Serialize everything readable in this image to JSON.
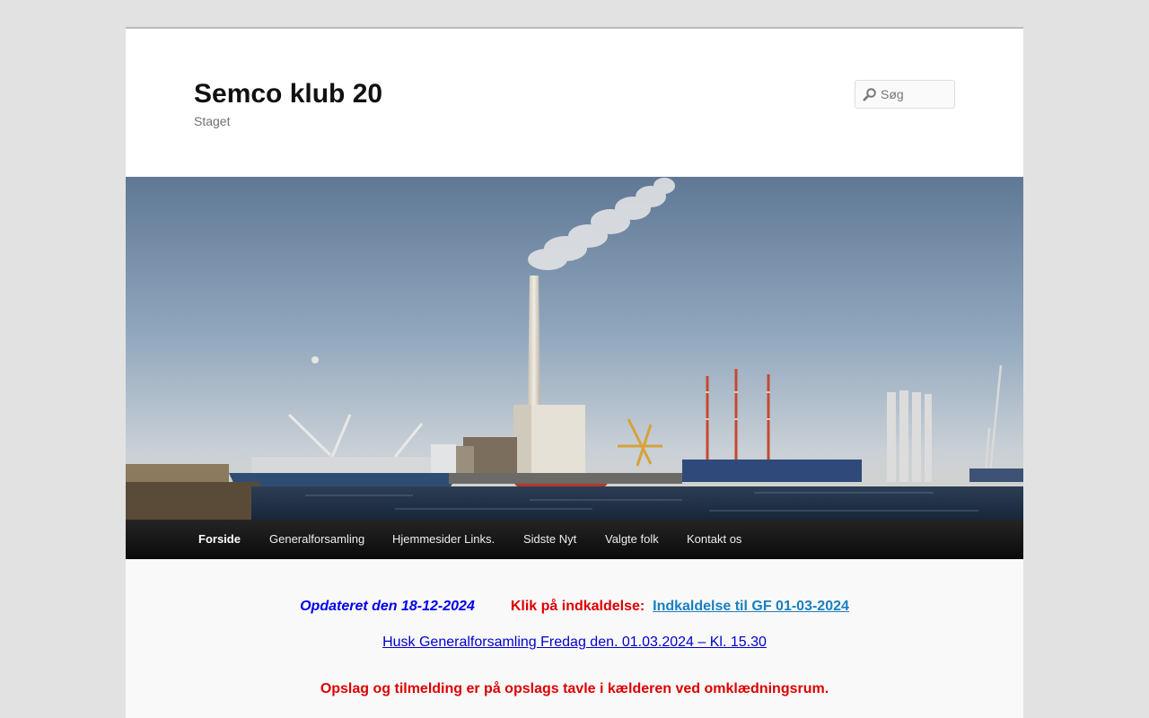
{
  "site": {
    "title": "Semco klub 20",
    "tagline": "Staget"
  },
  "search": {
    "placeholder": "Søg",
    "icon": "search-icon"
  },
  "nav": {
    "items": [
      {
        "label": "Forside",
        "active": true
      },
      {
        "label": "Generalforsamling"
      },
      {
        "label": "Hjemmesider Links."
      },
      {
        "label": "Sidste Nyt"
      },
      {
        "label": "Valgte folk"
      },
      {
        "label": "Kontakt os"
      }
    ]
  },
  "content": {
    "updated": "Opdateret den 18-12-2024",
    "klik_label": "Klik på indkaldelse:",
    "invitation_link": "Indkaldelse til GF 01-03-2024",
    "reminder_link": "Husk Generalforsamling Fredag den. 01.03.2024 – Kl. 15.30",
    "notice": "Opslag og tilmelding er på opslags tavle i kælderen ved omklædningsrum."
  },
  "colors": {
    "accent_blue": "#0000ee",
    "accent_red": "#dd0000",
    "link_blue": "#1a7fc1",
    "nav_bg": "#111111"
  }
}
